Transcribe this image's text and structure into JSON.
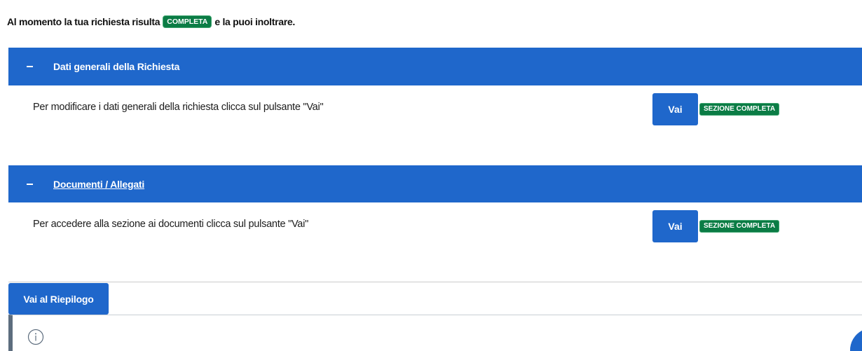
{
  "status": {
    "prefix": "Al momento la tua richiesta risulta",
    "badge": "COMPLETA",
    "suffix": "e la puoi inoltrare."
  },
  "sections": [
    {
      "toggle_icon": "minus-icon",
      "title": "Dati generali della Richiesta",
      "description": "Per modificare i dati generali della richiesta clicca sul pulsante \"Vai\"",
      "button_label": "Vai",
      "badge": "SEZIONE COMPLETA"
    },
    {
      "toggle_icon": "minus-icon",
      "title": "Documenti / Allegati",
      "description": "Per accedere alla sezione ai documenti clicca sul pulsante \"Vai\"",
      "button_label": "Vai",
      "badge": "SEZIONE COMPLETA"
    }
  ],
  "summary_button": {
    "label": "Vai al Riepilogo"
  },
  "info_box": {
    "icon": "info-circle-icon"
  },
  "colors": {
    "primary": "#1f67cb",
    "success": "#0b7c45",
    "info_border": "#5d6d7e"
  }
}
